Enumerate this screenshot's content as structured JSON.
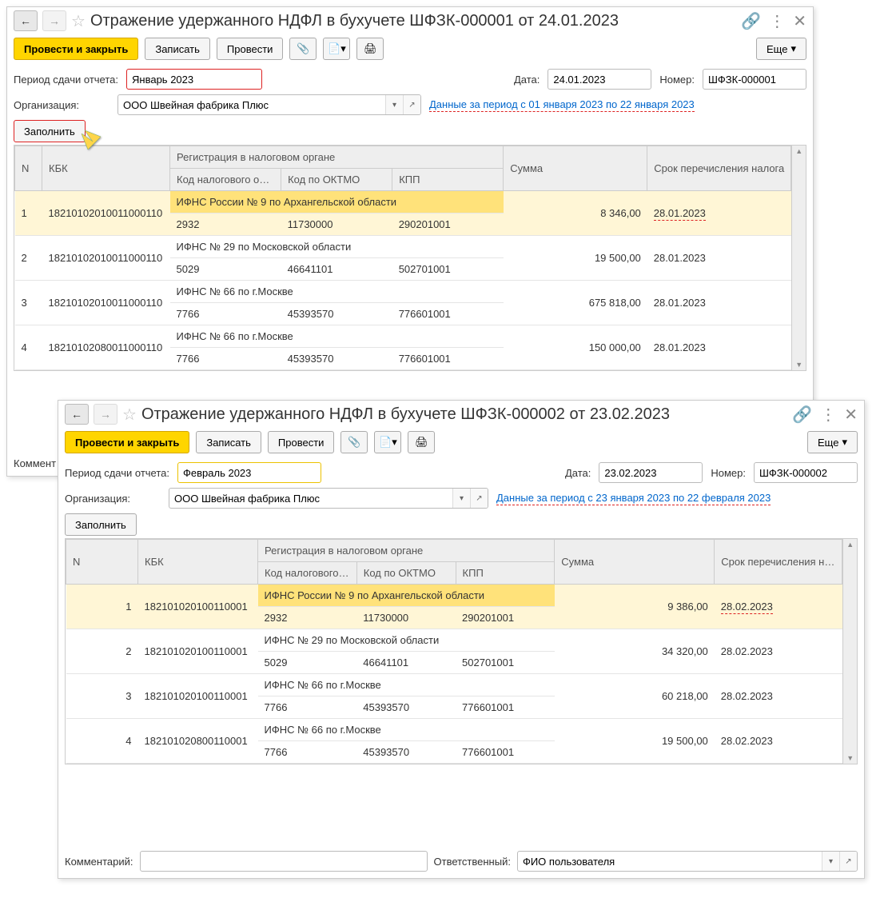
{
  "common": {
    "post_and_close": "Провести и закрыть",
    "write": "Записать",
    "post": "Провести",
    "more": "Еще",
    "period_label": "Период сдачи отчета:",
    "date_label": "Дата:",
    "number_label": "Номер:",
    "org_label": "Организация:",
    "fill": "Заполнить",
    "comment_label": "Комментарий:",
    "responsible_label": "Ответственный:",
    "responsible_value": "ФИО пользователя",
    "columns": {
      "n": "N",
      "kbk": "КБК",
      "reg": "Регистрация в налоговом органе",
      "taxcode": "Код налогового органа",
      "oktmo": "Код по ОКТМО",
      "kpp": "КПП",
      "sum": "Сумма",
      "deadline": "Срок перечисления налога"
    }
  },
  "w1": {
    "title": "Отражение удержанного НДФЛ в бухучете ШФЗК-000001 от 24.01.2023",
    "period": "Январь 2023",
    "date": "24.01.2023",
    "number": "ШФЗК-000001",
    "org": "ООО Швейная фабрика Плюс",
    "link": "Данные за период с 01 января 2023 по 22 января 2023",
    "comment": "Коммент",
    "rows": [
      {
        "n": "1",
        "kbk": "18210102010011000110",
        "reg": "ИФНС России № 9 по Архангельской области",
        "taxcode": "2932",
        "oktmo": "11730000",
        "kpp": "290201001",
        "sum": "8 346,00",
        "deadline": "28.01.2023",
        "hi": true
      },
      {
        "n": "2",
        "kbk": "18210102010011000110",
        "reg": "ИФНС № 29 по Московской области",
        "taxcode": "5029",
        "oktmo": "46641101",
        "kpp": "502701001",
        "sum": "19 500,00",
        "deadline": "28.01.2023"
      },
      {
        "n": "3",
        "kbk": "18210102010011000110",
        "reg": "ИФНС № 66 по г.Москве",
        "taxcode": "7766",
        "oktmo": "45393570",
        "kpp": "776601001",
        "sum": "675 818,00",
        "deadline": "28.01.2023"
      },
      {
        "n": "4",
        "kbk": "18210102080011000110",
        "reg": "ИФНС № 66 по г.Москве",
        "taxcode": "7766",
        "oktmo": "45393570",
        "kpp": "776601001",
        "sum": "150 000,00",
        "deadline": "28.01.2023"
      }
    ]
  },
  "w2": {
    "title": "Отражение удержанного НДФЛ в бухучете ШФЗК-000002 от 23.02.2023",
    "period": "Февраль 2023",
    "date": "23.02.2023",
    "number": "ШФЗК-000002",
    "org": "ООО Швейная фабрика Плюс",
    "link": "Данные за период с 23 января 2023 по 22 февраля 2023",
    "rows": [
      {
        "n": "1",
        "kbk": "182101020100110001",
        "reg": "ИФНС России № 9 по Архангельской области",
        "taxcode": "2932",
        "oktmo": "11730000",
        "kpp": "290201001",
        "sum": "9 386,00",
        "deadline": "28.02.2023",
        "hi": true
      },
      {
        "n": "2",
        "kbk": "182101020100110001",
        "reg": "ИФНС № 29 по Московской области",
        "taxcode": "5029",
        "oktmo": "46641101",
        "kpp": "502701001",
        "sum": "34 320,00",
        "deadline": "28.02.2023"
      },
      {
        "n": "3",
        "kbk": "182101020100110001",
        "reg": "ИФНС № 66 по г.Москве",
        "taxcode": "7766",
        "oktmo": "45393570",
        "kpp": "776601001",
        "sum": "60 218,00",
        "deadline": "28.02.2023"
      },
      {
        "n": "4",
        "kbk": "182101020800110001",
        "reg": "ИФНС № 66 по г.Москве",
        "taxcode": "7766",
        "oktmo": "45393570",
        "kpp": "776601001",
        "sum": "19 500,00",
        "deadline": "28.02.2023"
      }
    ]
  }
}
